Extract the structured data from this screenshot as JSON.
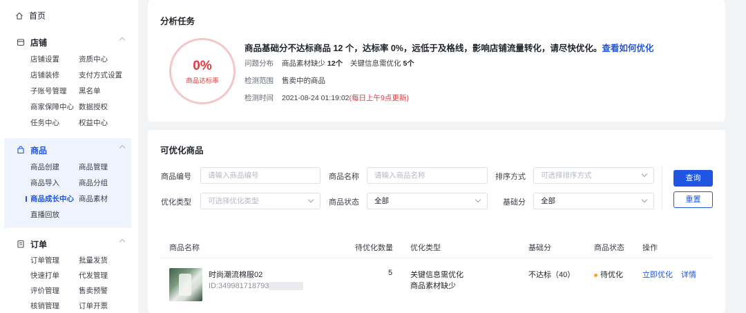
{
  "sidebar": {
    "home": "首页",
    "groups": [
      {
        "title": "店铺",
        "items": [
          "店铺设置",
          "资质中心",
          "店铺装修",
          "支付方式设置",
          "子账号管理",
          "黑名单",
          "商家保障中心",
          "数据授权",
          "任务中心",
          "权益中心"
        ]
      },
      {
        "title": "商品",
        "items": [
          "商品创建",
          "商品管理",
          "商品导入",
          "商品分组",
          "商品成长中心",
          "商品素材",
          "直播回放"
        ]
      },
      {
        "title": "订单",
        "items": [
          "订单管理",
          "批量发货",
          "快速打单",
          "代发管理",
          "评价管理",
          "售卖预警",
          "核销管理",
          "订单开票"
        ]
      }
    ]
  },
  "analysis": {
    "title": "分析任务",
    "ring_value": "0%",
    "ring_label": "商品达标率",
    "summary": "商品基础分不达标商品 12 个，达标率 0%，远低于及格线，影响店铺流量转化，请尽快优化。",
    "summary_link": "查看如何优化",
    "dist_label": "问题分布",
    "dist_a": "商品素材缺少",
    "dist_a_count": "12个",
    "dist_b": "关键信息需优化",
    "dist_b_count": "5个",
    "scope_label": "检测范围",
    "scope_value": "售卖中的商品",
    "time_label": "检测时间",
    "time_value": "2021-08-24 01:19:02",
    "time_note": "(每日上午9点更新)"
  },
  "optimize": {
    "title": "可优化商品",
    "filters": {
      "code_label": "商品编号",
      "code_placeholder": "请输入商品编号",
      "name_label": "商品名称",
      "name_placeholder": "请输入商品名称",
      "sort_label": "排序方式",
      "sort_placeholder": "可选择排序方式",
      "type_label": "优化类型",
      "type_placeholder": "可选择优化类型",
      "status_label": "商品状态",
      "status_value": "全部",
      "score_label": "基础分",
      "score_value": "全部"
    },
    "query_btn": "查询",
    "reset_btn": "重置",
    "columns": [
      "商品名称",
      "待优化数量",
      "优化类型",
      "基础分",
      "商品状态",
      "操作"
    ],
    "rows": [
      {
        "name": "时尚潮流棉服02",
        "id": "ID:349981718793",
        "count": "5",
        "type_1": "关键信息需优化",
        "type_2": "商品素材缺少",
        "score": "不达标（40）",
        "status": "待优化",
        "action_optimize": "立即优化",
        "action_detail": "详情"
      }
    ]
  }
}
